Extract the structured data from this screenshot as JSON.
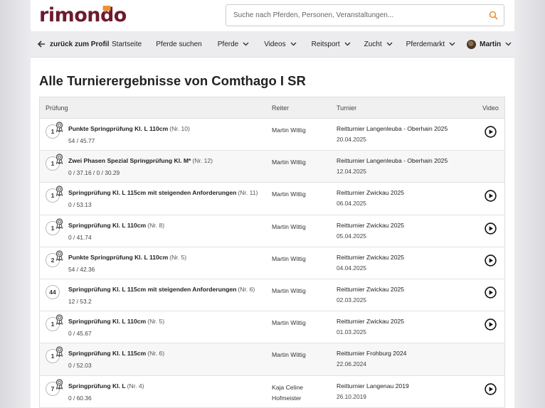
{
  "header": {
    "logo_text": "rimondo",
    "search_placeholder": "Suche nach Pferden, Personen, Veranstaltungen..."
  },
  "nav": {
    "back_label": "zurück zum Profil",
    "items": [
      "Startseite",
      "Pferde suchen",
      "Pferde",
      "Videos",
      "Reitsport",
      "Zucht",
      "Pferdemarkt"
    ],
    "user_name": "Martin"
  },
  "page_title": "Alle Turnierergebnisse von Comthago I SR",
  "table": {
    "columns": {
      "pruefung": "Prüfung",
      "reiter": "Reiter",
      "turnier": "Turnier",
      "video": "Video"
    },
    "rows": [
      {
        "place": "1",
        "ribbon": true,
        "competition": "Punkte Springprüfung Kl. L 110cm",
        "nr": "(Nr. 10)",
        "score": "54 / 45.77",
        "rider": "Martin Wittig",
        "tournament": "Reitturnier Langenleuba - Oberhain 2025",
        "date": "20.04.2025",
        "video": true
      },
      {
        "place": "1",
        "ribbon": true,
        "competition": "Zwei Phasen Spezial Springprüfung Kl. M*",
        "nr": "(Nr. 12)",
        "score": "0 / 37.16 / 0 / 30.29",
        "rider": "Martin Wittig",
        "tournament": "Reitturnier Langenleuba - Oberhain 2025",
        "date": "12.04.2025",
        "video": false
      },
      {
        "place": "1",
        "ribbon": true,
        "competition": "Springprüfung Kl. L 115cm mit steigenden Anforderungen",
        "nr": "(Nr. 11)",
        "score": "0 / 53.13",
        "rider": "Martin Wittig",
        "tournament": "Reitturnier Zwickau 2025",
        "date": "06.04.2025",
        "video": true
      },
      {
        "place": "1",
        "ribbon": true,
        "competition": "Springprüfung Kl. L 110cm",
        "nr": "(Nr. 8)",
        "score": "0 / 41.74",
        "rider": "Martin Wittig",
        "tournament": "Reitturnier Zwickau 2025",
        "date": "05.04.2025",
        "video": true
      },
      {
        "place": "2",
        "ribbon": true,
        "competition": "Punkte Springprüfung Kl. L 110cm",
        "nr": "(Nr. 5)",
        "score": "54 / 42.36",
        "rider": "Martin Wittig",
        "tournament": "Reitturnier Zwickau 2025",
        "date": "04.04.2025",
        "video": true
      },
      {
        "place": "44",
        "ribbon": false,
        "competition": "Springprüfung Kl. L 115cm mit steigenden Anforderungen",
        "nr": "(Nr. 6)",
        "score": "12 / 53.2",
        "rider": "Martin Wittig",
        "tournament": "Reitturnier Zwickau 2025",
        "date": "02.03.2025",
        "video": true
      },
      {
        "place": "1",
        "ribbon": true,
        "competition": "Springprüfung Kl. L 110cm",
        "nr": "(Nr. 5)",
        "score": "0 / 45.67",
        "rider": "Martin Wittig",
        "tournament": "Reitturnier Zwickau 2025",
        "date": "01.03.2025",
        "video": true
      },
      {
        "place": "1",
        "ribbon": true,
        "competition": "Springprüfung Kl. L 115cm",
        "nr": "(Nr. 6)",
        "score": "0 / 52.03",
        "rider": "Martin Wittig",
        "tournament": "Reitturnier Frohburg 2024",
        "date": "22.06.2024",
        "video": false
      },
      {
        "place": "7",
        "ribbon": true,
        "competition": "Springprüfung Kl. L",
        "nr": "(Nr. 4)",
        "score": "0 / 60.36",
        "rider": "Kaja Celine Hofmeister",
        "tournament": "Reitturnier Langenau 2019",
        "date": "26.10.2019",
        "video": true
      }
    ]
  },
  "colors": {
    "brand": "#6d1a2e",
    "accent": "#e8943a"
  }
}
